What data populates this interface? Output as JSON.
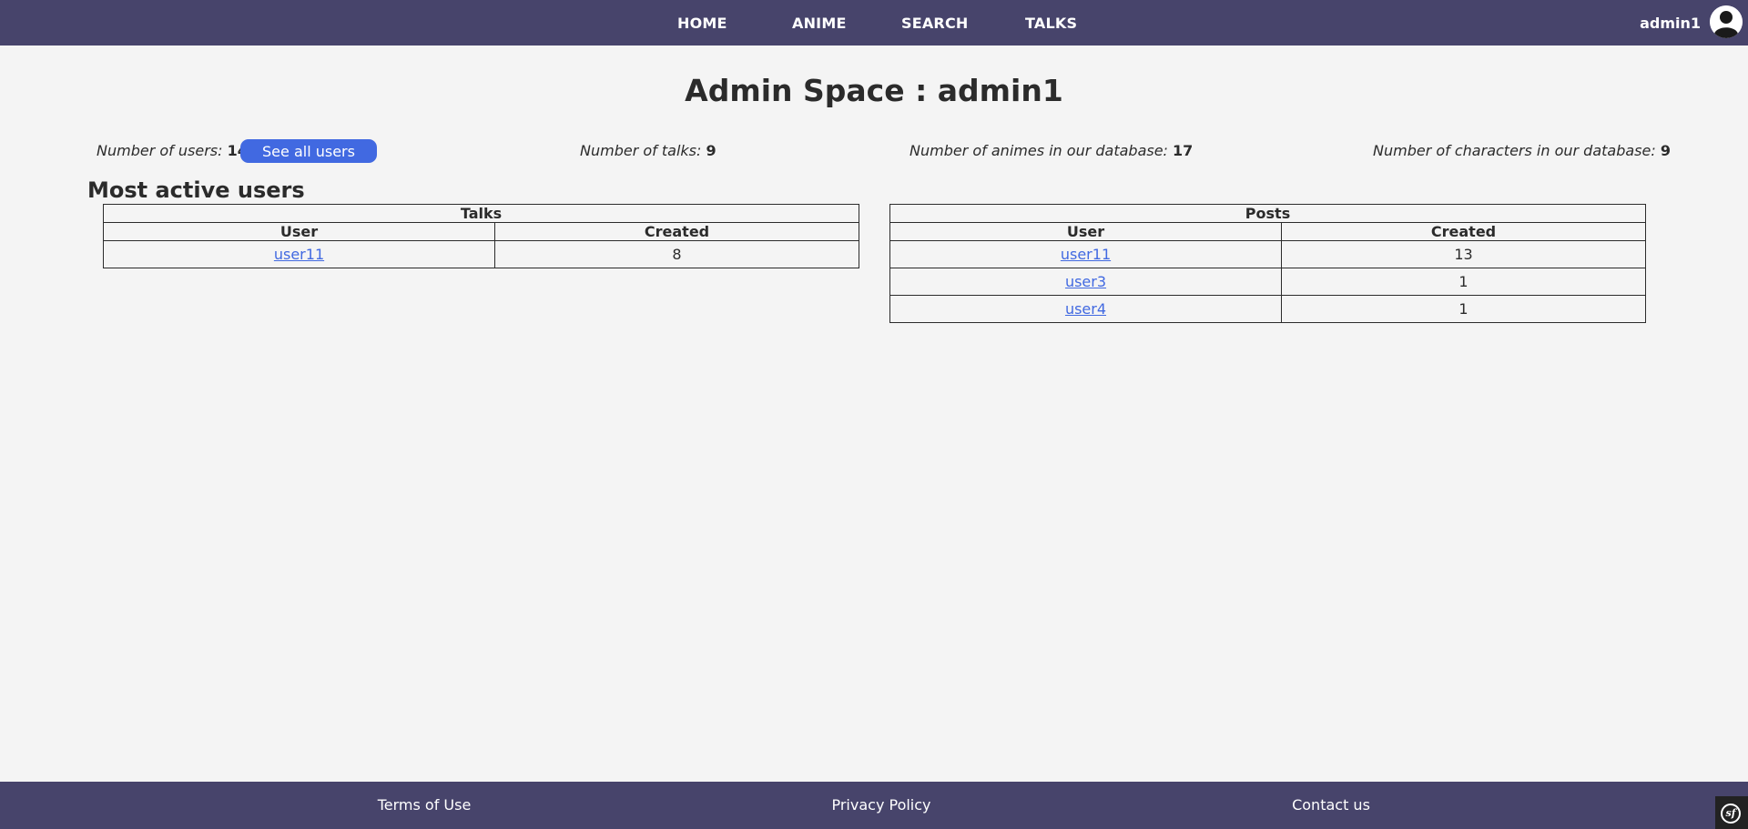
{
  "nav": {
    "links": [
      "HOME",
      "ANIME",
      "SEARCH",
      "TALKS"
    ],
    "username": "admin1",
    "avatar_icon": "user-avatar-icon"
  },
  "page": {
    "title": "Admin Space : admin1"
  },
  "stats": {
    "users_label": "Number of users:",
    "users_value": "14",
    "see_all_label": "See all users",
    "talks_label": "Number of talks:",
    "talks_value": "9",
    "animes_label": "Number of animes in our database:",
    "animes_value": "17",
    "characters_label": "Number of characters in our database:",
    "characters_value": "9"
  },
  "most_active": {
    "title": "Most active users",
    "talks_table": {
      "caption": "Talks",
      "headers": [
        "User",
        "Created"
      ],
      "rows": [
        {
          "user": "user11",
          "created": "8"
        }
      ]
    },
    "posts_table": {
      "caption": "Posts",
      "headers": [
        "User",
        "Created"
      ],
      "rows": [
        {
          "user": "user11",
          "created": "13"
        },
        {
          "user": "user3",
          "created": "1"
        },
        {
          "user": "user4",
          "created": "1"
        }
      ]
    }
  },
  "footer": {
    "links": [
      "Terms of Use",
      "Privacy Policy",
      "Contact us"
    ],
    "badge_icon": "symfony-toolbar-icon",
    "badge_text": "sf"
  },
  "colors": {
    "nav_bg": "#47446b",
    "page_bg": "#f4f4f4",
    "accent": "#4169e1"
  }
}
